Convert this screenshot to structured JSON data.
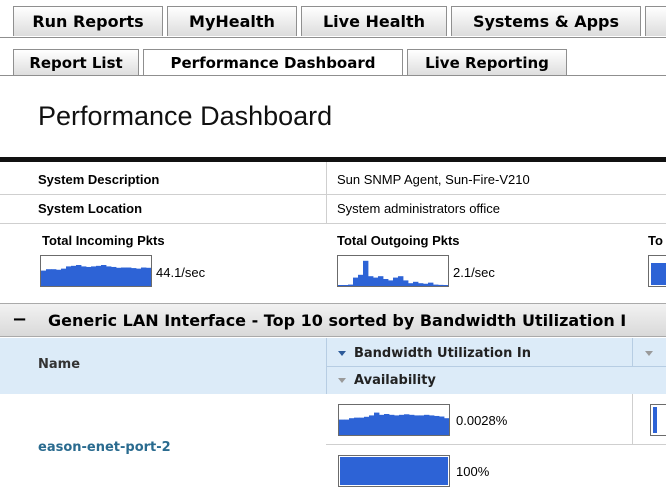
{
  "top_tabs": [
    {
      "label": "Run Reports"
    },
    {
      "label": "MyHealth"
    },
    {
      "label": "Live Health"
    },
    {
      "label": "Systems & Apps"
    }
  ],
  "sub_tabs": [
    {
      "label": "Report List"
    },
    {
      "label": "Performance Dashboard"
    },
    {
      "label": "Live Reporting"
    }
  ],
  "page_title": "Performance Dashboard",
  "system": {
    "description_label": "System Description",
    "description_value": "Sun SNMP Agent, Sun-Fire-V210",
    "location_label": "System Location",
    "location_value": "System administrators office"
  },
  "metrics": [
    {
      "label": "Total Incoming Pkts",
      "value": "44.1/sec",
      "levels": [
        0.55,
        0.6,
        0.6,
        0.58,
        0.62,
        0.7,
        0.72,
        0.75,
        0.7,
        0.68,
        0.7,
        0.72,
        0.75,
        0.7,
        0.68,
        0.65,
        0.66,
        0.66,
        0.64,
        0.62,
        0.66,
        0.65
      ]
    },
    {
      "label": "Total Outgoing Pkts",
      "value": "2.1/sec",
      "levels": [
        0.02,
        0.03,
        0.05,
        0.3,
        0.4,
        0.9,
        0.35,
        0.3,
        0.35,
        0.25,
        0.2,
        0.3,
        0.35,
        0.2,
        0.1,
        0.15,
        0.1,
        0.08,
        0.12,
        0.05,
        0.04,
        0.03
      ]
    },
    {
      "label": "To"
    }
  ],
  "section": {
    "collapse_symbol": "−",
    "title": "Generic LAN Interface - Top 10 sorted by Bandwidth Utilization I"
  },
  "table": {
    "name_header": "Name",
    "bandwidth_header": "Bandwidth Utilization In",
    "availability_header": "Availability",
    "rows": [
      {
        "name": "eason-enet-port-2",
        "bandwidth_value": "0.0028%",
        "bandwidth_levels": [
          0.55,
          0.55,
          0.6,
          0.62,
          0.62,
          0.65,
          0.7,
          0.8,
          0.72,
          0.75,
          0.72,
          0.7,
          0.72,
          0.74,
          0.72,
          0.7,
          0.7,
          0.72,
          0.7,
          0.68,
          0.66,
          0.6
        ],
        "availability_value": "100%",
        "availability_level": 1.0
      }
    ]
  },
  "colors": {
    "accent_blue": "#2d63d6",
    "link": "#2a6b8f",
    "header_band": "#dcebf8"
  }
}
